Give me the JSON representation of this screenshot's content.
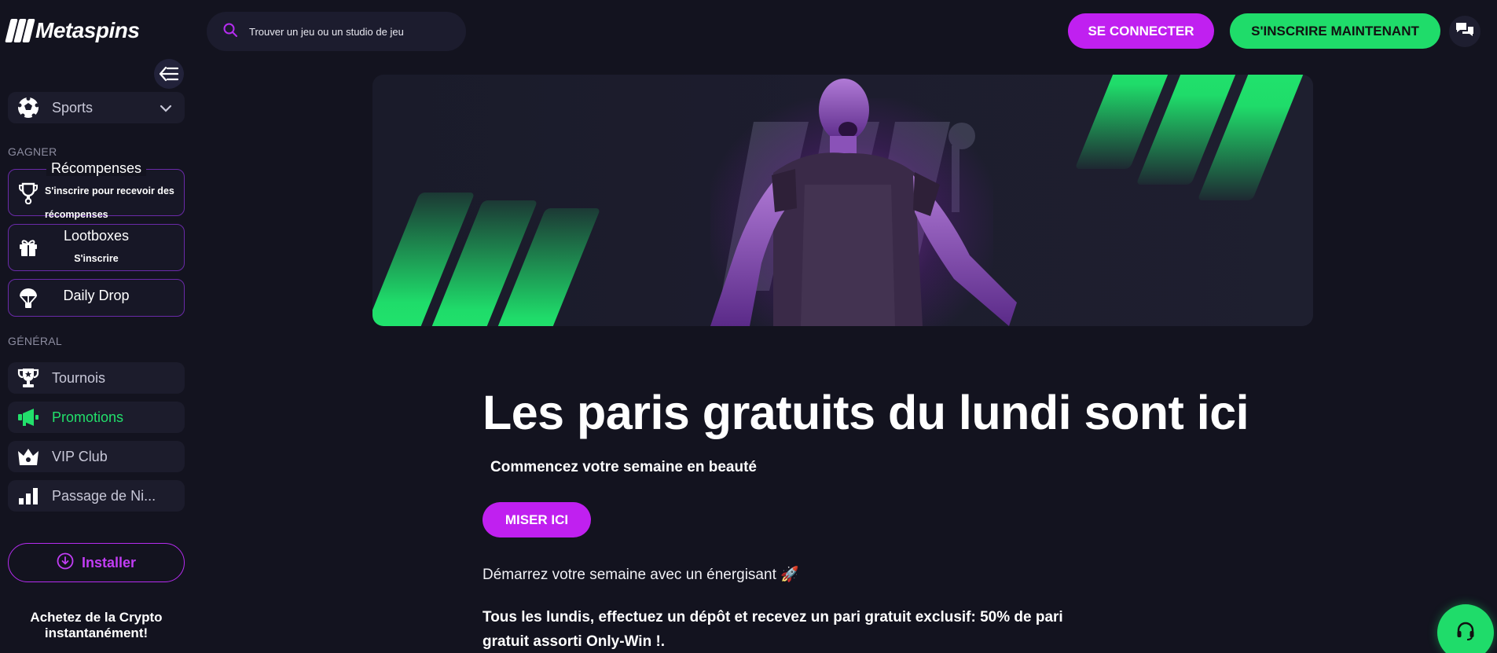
{
  "brand": {
    "name": "Metaspins"
  },
  "search": {
    "placeholder": "Trouver un jeu ou un studio de jeu"
  },
  "header": {
    "login_label": "SE CONNECTER",
    "register_label": "S'INSCRIRE MAINTENANT"
  },
  "sidebar": {
    "sports_label": "Sports",
    "earn_section": "GAGNER",
    "rewards": {
      "title": "Récompenses",
      "subtitle_line1": "S'inscrire pour recevoir des",
      "subtitle_line2": "récompenses"
    },
    "lootboxes": {
      "title": "Lootboxes",
      "subtitle": "S'inscrire"
    },
    "daily_drop": {
      "title": "Daily Drop"
    },
    "general_section": "GÉNÉRAL",
    "items": [
      {
        "label": "Tournois",
        "icon": "trophy-icon"
      },
      {
        "label": "Promotions",
        "icon": "megaphone-icon"
      },
      {
        "label": "VIP Club",
        "icon": "crown-icon"
      },
      {
        "label": "Passage de Ni...",
        "icon": "bar-chart-icon"
      }
    ],
    "install_label": "Installer",
    "crypto_line1": "Achetez de la Crypto",
    "crypto_line2": "instantanément!"
  },
  "main": {
    "headline": "Les paris gratuits du lundi sont ici",
    "subheadline": "Commencez votre semaine en beauté",
    "cta_label": "MISER ICI",
    "intro_text": "Démarrez votre semaine avec un énergisant 🚀",
    "body_line1": "Tous les lundis, effectuez un dépôt et recevez un pari gratuit exclusif: 50% de pari",
    "body_line2": "gratuit assorti Only-Win !."
  },
  "colors": {
    "background": "#13131f",
    "accent_purple": "#c020f0",
    "accent_green": "#1fdc6a",
    "card_border": "#6a2aa8"
  }
}
